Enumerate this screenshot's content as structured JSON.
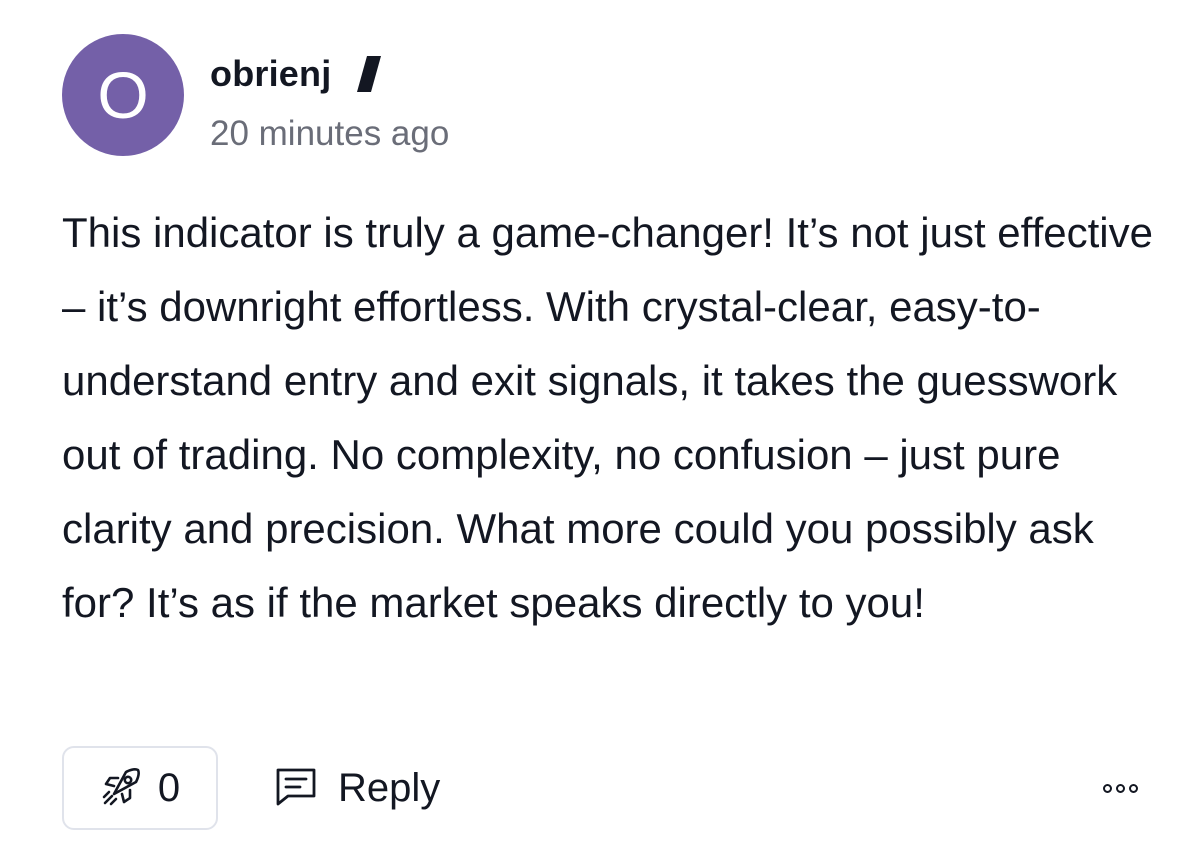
{
  "comment": {
    "avatar": {
      "letter": "O",
      "color": "#7460a8"
    },
    "username": "obrienj",
    "badge_icon": "pencil-stroke-badge",
    "timestamp": "20 minutes ago",
    "body": "This indicator is truly a game-changer! It’s not just effective – it’s downright effortless. With crystal-clear, easy-to-understand entry and exit signals, it takes the guesswork out of trading. No complexity, no confusion – just pure clarity and precision. What more could you possibly ask for? It’s as if the market speaks directly to you!",
    "actions": {
      "boost_icon": "rocket-icon",
      "boost_count": "0",
      "reply_icon": "comment-icon",
      "reply_label": "Reply",
      "more_icon": "more-dots-icon"
    }
  }
}
